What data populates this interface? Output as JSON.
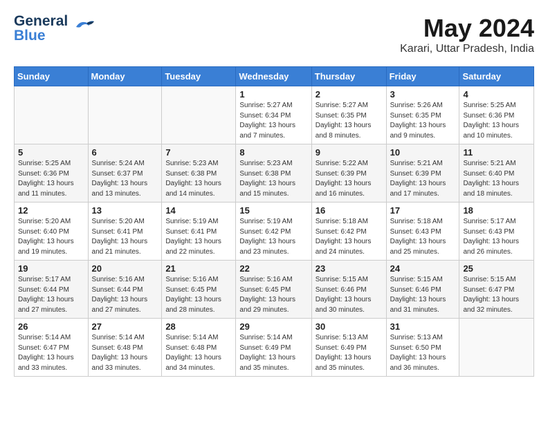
{
  "logo": {
    "line1": "General",
    "line2": "Blue"
  },
  "title": {
    "month_year": "May 2024",
    "location": "Karari, Uttar Pradesh, India"
  },
  "weekdays": [
    "Sunday",
    "Monday",
    "Tuesday",
    "Wednesday",
    "Thursday",
    "Friday",
    "Saturday"
  ],
  "weeks": [
    [
      {
        "day": "",
        "info": ""
      },
      {
        "day": "",
        "info": ""
      },
      {
        "day": "",
        "info": ""
      },
      {
        "day": "1",
        "info": "Sunrise: 5:27 AM\nSunset: 6:34 PM\nDaylight: 13 hours\nand 7 minutes."
      },
      {
        "day": "2",
        "info": "Sunrise: 5:27 AM\nSunset: 6:35 PM\nDaylight: 13 hours\nand 8 minutes."
      },
      {
        "day": "3",
        "info": "Sunrise: 5:26 AM\nSunset: 6:35 PM\nDaylight: 13 hours\nand 9 minutes."
      },
      {
        "day": "4",
        "info": "Sunrise: 5:25 AM\nSunset: 6:36 PM\nDaylight: 13 hours\nand 10 minutes."
      }
    ],
    [
      {
        "day": "5",
        "info": "Sunrise: 5:25 AM\nSunset: 6:36 PM\nDaylight: 13 hours\nand 11 minutes."
      },
      {
        "day": "6",
        "info": "Sunrise: 5:24 AM\nSunset: 6:37 PM\nDaylight: 13 hours\nand 13 minutes."
      },
      {
        "day": "7",
        "info": "Sunrise: 5:23 AM\nSunset: 6:38 PM\nDaylight: 13 hours\nand 14 minutes."
      },
      {
        "day": "8",
        "info": "Sunrise: 5:23 AM\nSunset: 6:38 PM\nDaylight: 13 hours\nand 15 minutes."
      },
      {
        "day": "9",
        "info": "Sunrise: 5:22 AM\nSunset: 6:39 PM\nDaylight: 13 hours\nand 16 minutes."
      },
      {
        "day": "10",
        "info": "Sunrise: 5:21 AM\nSunset: 6:39 PM\nDaylight: 13 hours\nand 17 minutes."
      },
      {
        "day": "11",
        "info": "Sunrise: 5:21 AM\nSunset: 6:40 PM\nDaylight: 13 hours\nand 18 minutes."
      }
    ],
    [
      {
        "day": "12",
        "info": "Sunrise: 5:20 AM\nSunset: 6:40 PM\nDaylight: 13 hours\nand 19 minutes."
      },
      {
        "day": "13",
        "info": "Sunrise: 5:20 AM\nSunset: 6:41 PM\nDaylight: 13 hours\nand 21 minutes."
      },
      {
        "day": "14",
        "info": "Sunrise: 5:19 AM\nSunset: 6:41 PM\nDaylight: 13 hours\nand 22 minutes."
      },
      {
        "day": "15",
        "info": "Sunrise: 5:19 AM\nSunset: 6:42 PM\nDaylight: 13 hours\nand 23 minutes."
      },
      {
        "day": "16",
        "info": "Sunrise: 5:18 AM\nSunset: 6:42 PM\nDaylight: 13 hours\nand 24 minutes."
      },
      {
        "day": "17",
        "info": "Sunrise: 5:18 AM\nSunset: 6:43 PM\nDaylight: 13 hours\nand 25 minutes."
      },
      {
        "day": "18",
        "info": "Sunrise: 5:17 AM\nSunset: 6:43 PM\nDaylight: 13 hours\nand 26 minutes."
      }
    ],
    [
      {
        "day": "19",
        "info": "Sunrise: 5:17 AM\nSunset: 6:44 PM\nDaylight: 13 hours\nand 27 minutes."
      },
      {
        "day": "20",
        "info": "Sunrise: 5:16 AM\nSunset: 6:44 PM\nDaylight: 13 hours\nand 27 minutes."
      },
      {
        "day": "21",
        "info": "Sunrise: 5:16 AM\nSunset: 6:45 PM\nDaylight: 13 hours\nand 28 minutes."
      },
      {
        "day": "22",
        "info": "Sunrise: 5:16 AM\nSunset: 6:45 PM\nDaylight: 13 hours\nand 29 minutes."
      },
      {
        "day": "23",
        "info": "Sunrise: 5:15 AM\nSunset: 6:46 PM\nDaylight: 13 hours\nand 30 minutes."
      },
      {
        "day": "24",
        "info": "Sunrise: 5:15 AM\nSunset: 6:46 PM\nDaylight: 13 hours\nand 31 minutes."
      },
      {
        "day": "25",
        "info": "Sunrise: 5:15 AM\nSunset: 6:47 PM\nDaylight: 13 hours\nand 32 minutes."
      }
    ],
    [
      {
        "day": "26",
        "info": "Sunrise: 5:14 AM\nSunset: 6:47 PM\nDaylight: 13 hours\nand 33 minutes."
      },
      {
        "day": "27",
        "info": "Sunrise: 5:14 AM\nSunset: 6:48 PM\nDaylight: 13 hours\nand 33 minutes."
      },
      {
        "day": "28",
        "info": "Sunrise: 5:14 AM\nSunset: 6:48 PM\nDaylight: 13 hours\nand 34 minutes."
      },
      {
        "day": "29",
        "info": "Sunrise: 5:14 AM\nSunset: 6:49 PM\nDaylight: 13 hours\nand 35 minutes."
      },
      {
        "day": "30",
        "info": "Sunrise: 5:13 AM\nSunset: 6:49 PM\nDaylight: 13 hours\nand 35 minutes."
      },
      {
        "day": "31",
        "info": "Sunrise: 5:13 AM\nSunset: 6:50 PM\nDaylight: 13 hours\nand 36 minutes."
      },
      {
        "day": "",
        "info": ""
      }
    ]
  ]
}
